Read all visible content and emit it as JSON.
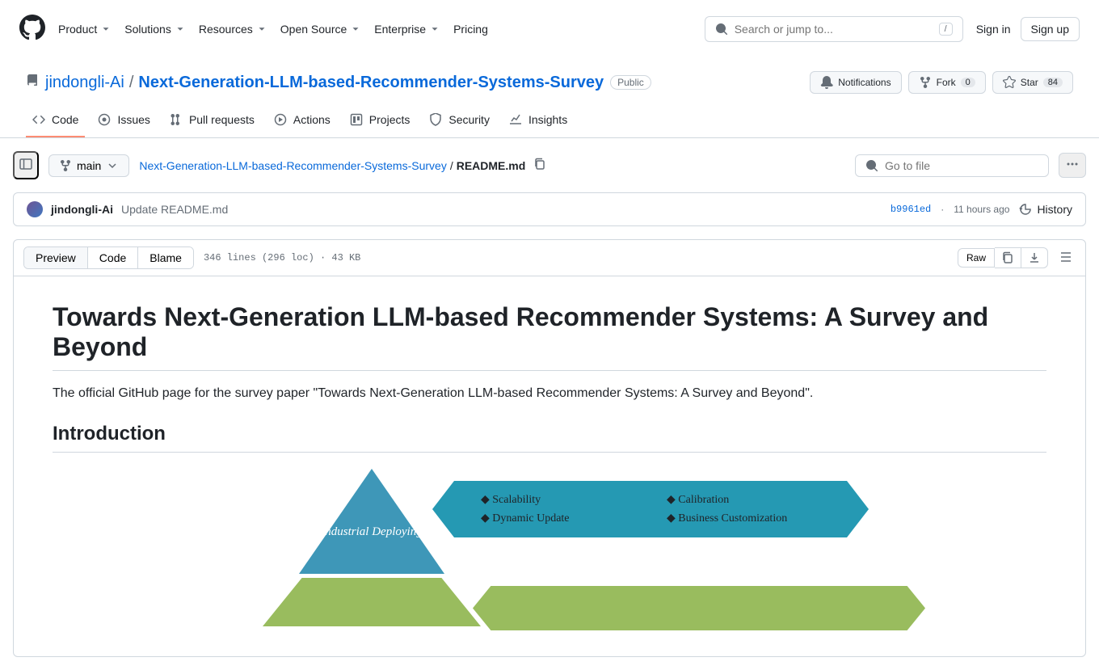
{
  "header": {
    "nav": {
      "product": "Product",
      "solutions": "Solutions",
      "resources": "Resources",
      "open_source": "Open Source",
      "enterprise": "Enterprise",
      "pricing": "Pricing"
    },
    "search_placeholder": "Search or jump to...",
    "search_kbd": "/",
    "sign_in": "Sign in",
    "sign_up": "Sign up"
  },
  "repo": {
    "owner": "jindongli-Ai",
    "name": "Next-Generation-LLM-based-Recommender-Systems-Survey",
    "visibility": "Public",
    "notifications": "Notifications",
    "fork": "Fork",
    "fork_count": "0",
    "star": "Star",
    "star_count": "84"
  },
  "tabs": {
    "code": "Code",
    "issues": "Issues",
    "pull_requests": "Pull requests",
    "actions": "Actions",
    "projects": "Projects",
    "security": "Security",
    "insights": "Insights"
  },
  "filenav": {
    "branch": "main",
    "breadcrumb_repo": "Next-Generation-LLM-based-Recommender-Systems-Survey",
    "breadcrumb_file": "README.md",
    "go_to_file": "Go to file"
  },
  "commit": {
    "author": "jindongli-Ai",
    "message": "Update README.md",
    "hash": "b9961ed",
    "sep": "·",
    "time": "11 hours ago",
    "history": "History"
  },
  "file": {
    "view_preview": "Preview",
    "view_code": "Code",
    "view_blame": "Blame",
    "stats": "346 lines (296 loc) · 43 KB",
    "raw": "Raw"
  },
  "readme": {
    "title": "Towards Next-Generation LLM-based Recommender Systems: A Survey and Beyond",
    "intro_text": "The official GitHub page for the survey paper \"Towards Next-Generation LLM-based Recommender Systems: A Survey and Beyond\".",
    "intro_heading": "Introduction",
    "pyramid_top": "Industrial Deploying",
    "banner1_items": [
      "◆ Scalability",
      "◆ Calibration",
      "◆ Dynamic Update",
      "◆ Business Customization"
    ]
  }
}
